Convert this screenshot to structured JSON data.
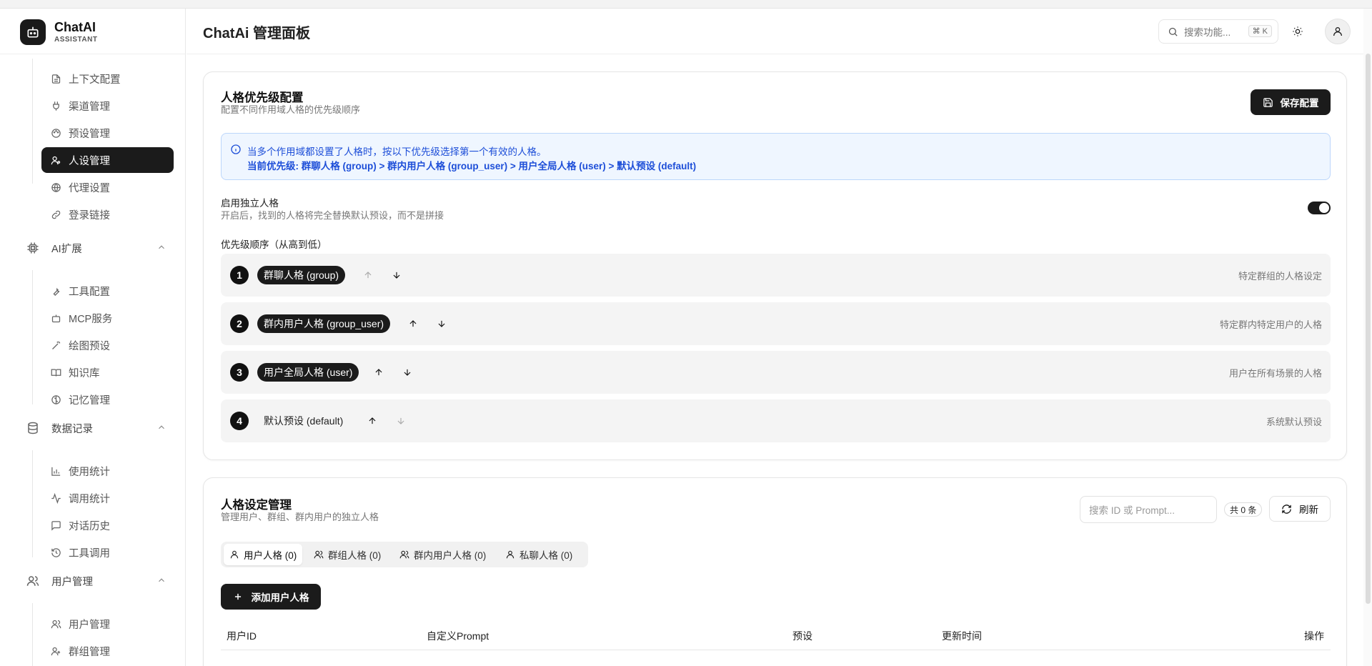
{
  "brand": {
    "name": "ChatAI",
    "sub": "ASSISTANT"
  },
  "header": {
    "title": "ChatAi 管理面板",
    "search_placeholder": "搜索功能...",
    "shortcut": "⌘ K"
  },
  "sidebar": {
    "items_top": [
      {
        "label": "上下文配置",
        "icon": "file-text-icon"
      },
      {
        "label": "渠道管理",
        "icon": "plug-icon"
      },
      {
        "label": "预设管理",
        "icon": "palette-icon"
      },
      {
        "label": "人设管理",
        "icon": "user-persona-icon",
        "active": true
      },
      {
        "label": "代理设置",
        "icon": "globe-icon"
      },
      {
        "label": "登录链接",
        "icon": "link-icon"
      }
    ],
    "groups": [
      {
        "label": "AI扩展",
        "icon": "cpu-icon",
        "items": [
          {
            "label": "工具配置",
            "icon": "wrench-icon"
          },
          {
            "label": "MCP服务",
            "icon": "bot-icon"
          },
          {
            "label": "绘图预设",
            "icon": "wand-icon"
          },
          {
            "label": "知识库",
            "icon": "book-icon"
          },
          {
            "label": "记忆管理",
            "icon": "brain-icon"
          }
        ]
      },
      {
        "label": "数据记录",
        "icon": "database-icon",
        "items": [
          {
            "label": "使用统计",
            "icon": "bar-chart-icon"
          },
          {
            "label": "调用统计",
            "icon": "activity-icon"
          },
          {
            "label": "对话历史",
            "icon": "message-icon"
          },
          {
            "label": "工具调用",
            "icon": "history-icon"
          }
        ]
      },
      {
        "label": "用户管理",
        "icon": "users-icon",
        "items": [
          {
            "label": "用户管理",
            "icon": "users-icon"
          },
          {
            "label": "群组管理",
            "icon": "group-icon"
          }
        ]
      }
    ]
  },
  "priority_card": {
    "title": "人格优先级配置",
    "desc": "配置不同作用域人格的优先级顺序",
    "save_label": "保存配置",
    "info_line1": "当多个作用域都设置了人格时，按以下优先级选择第一个有效的人格。",
    "info_line2": "当前优先级: 群聊人格 (group) > 群内用户人格 (group_user) > 用户全局人格 (user) > 默认预设 (default)",
    "toggle_title": "启用独立人格",
    "toggle_desc": "开启后，找到的人格将完全替换默认预设，而不是拼接",
    "toggle_on": true,
    "order_label": "优先级顺序（从高到低）",
    "rows": [
      {
        "num": "1",
        "chip": "群聊人格 (group)",
        "hint": "特定群组的人格设定"
      },
      {
        "num": "2",
        "chip": "群内用户人格 (group_user)",
        "hint": "特定群内特定用户的人格"
      },
      {
        "num": "3",
        "chip": "用户全局人格 (user)",
        "hint": "用户在所有场景的人格"
      },
      {
        "num": "4",
        "chip": "默认预设 (default)",
        "hint": "系统默认预设"
      }
    ]
  },
  "persona_card": {
    "title": "人格设定管理",
    "desc": "管理用户、群组、群内用户的独立人格",
    "search_placeholder": "搜索 ID 或 Prompt...",
    "count": "共 0 条",
    "refresh_label": "刷新",
    "tabs": [
      {
        "label": "用户人格 (0)",
        "icon": "user-icon",
        "active": true
      },
      {
        "label": "群组人格 (0)",
        "icon": "users-icon"
      },
      {
        "label": "群内用户人格 (0)",
        "icon": "users-icon"
      },
      {
        "label": "私聊人格 (0)",
        "icon": "user-icon"
      }
    ],
    "add_label": "添加用户人格",
    "columns": [
      "用户ID",
      "自定义Prompt",
      "预设",
      "更新时间",
      "操作"
    ]
  },
  "colors": {
    "accent": "#1b1b1b",
    "info_bg": "#eff6ff",
    "info_text": "#1d4ed8"
  }
}
